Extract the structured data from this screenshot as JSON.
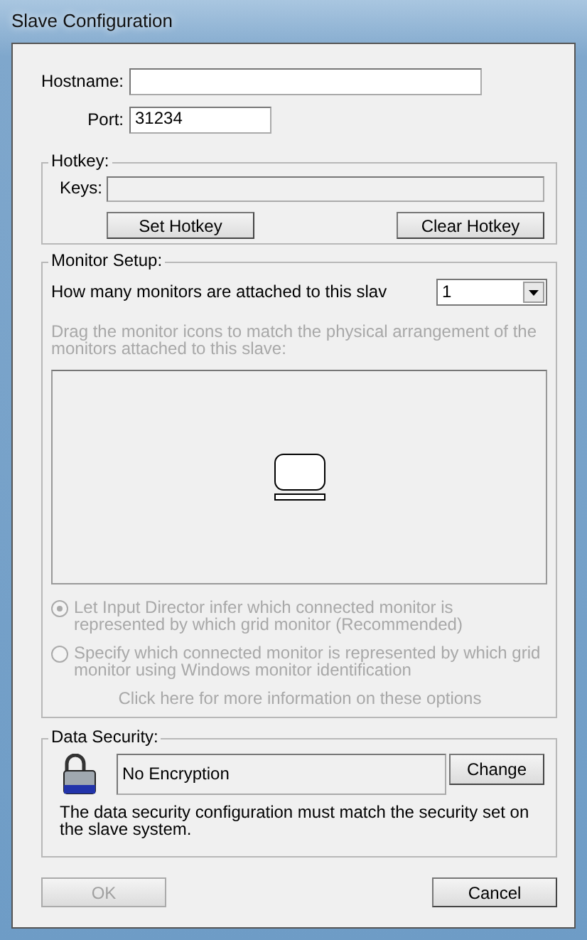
{
  "window": {
    "title": "Slave Configuration"
  },
  "hostname": {
    "label": "Hostname:"
  },
  "port": {
    "label": "Port:",
    "value": "31234"
  },
  "hotkey": {
    "title": "Hotkey:",
    "keys_label": "Keys:",
    "buttons": [
      {
        "label": "Set Hotkey",
        "disabled": false
      },
      {
        "label": "Clear Hotkey",
        "disabled": false
      }
    ]
  },
  "monitor_setup": {
    "title": "Monitor Setup:",
    "question": "How many monitors are attached to this slav",
    "count": "1",
    "instructions": {
      "text": "Drag the monitor icons to match the physical arrangement of the monitors attached to this slave:",
      "disabled": true
    },
    "options": [
      {
        "label": "Let Input Director infer which connected monitor is represented by which grid monitor (Recommended)",
        "selected": true,
        "disabled": true
      },
      {
        "label": "Specify which connected monitor is represented by which grid monitor using Windows monitor identification",
        "selected": false,
        "disabled": true
      }
    ],
    "info_link": {
      "text": "Click here for more information on these options",
      "disabled": true
    }
  },
  "data_security": {
    "title": "Data Security:",
    "encryption": "No Encryption",
    "button": "Change",
    "note": "The data security configuration must match the security set on the slave system."
  },
  "buttons": [
    {
      "label": "OK",
      "disabled": true
    },
    {
      "label": "Cancel",
      "disabled": false
    }
  ]
}
